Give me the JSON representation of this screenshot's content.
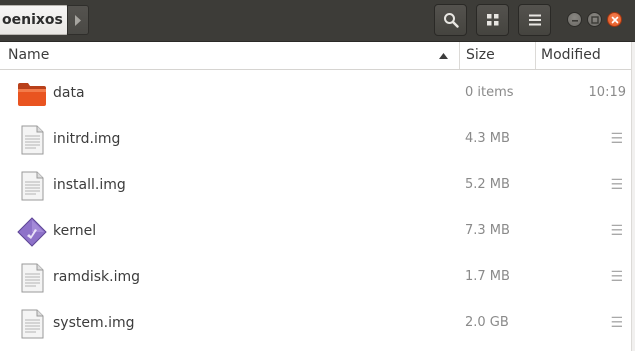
{
  "header": {
    "breadcrumb": "oenixos",
    "icons": {
      "next": "chevron-right-icon",
      "search": "search-icon",
      "view": "grid-view-icon",
      "menu": "hamburger-menu-icon",
      "minimize": "minimize-icon",
      "maximize": "maximize-icon",
      "close": "close-icon"
    }
  },
  "columns": {
    "name": "Name",
    "size": "Size",
    "modified": "Modified",
    "sort_icon": "sort-ascending-icon"
  },
  "files": [
    {
      "name": "data",
      "size": "0 items",
      "modified": "10:19",
      "icon": "folder-icon"
    },
    {
      "name": "initrd.img",
      "size": "4.3 MB",
      "modified": "☰",
      "icon": "text-file-icon"
    },
    {
      "name": "install.img",
      "size": "5.2 MB",
      "modified": "☰",
      "icon": "text-file-icon"
    },
    {
      "name": "kernel",
      "size": "7.3 MB",
      "modified": "☰",
      "icon": "executable-file-icon"
    },
    {
      "name": "ramdisk.img",
      "size": "1.7 MB",
      "modified": "☰",
      "icon": "text-file-icon"
    },
    {
      "name": "system.img",
      "size": "2.0 GB",
      "modified": "☰",
      "icon": "text-file-icon"
    }
  ],
  "colors": {
    "headerbar": "#3d3c38",
    "folder": "#e95420",
    "close_button": "#e2571e",
    "secondary_text": "#8a8a8a"
  }
}
